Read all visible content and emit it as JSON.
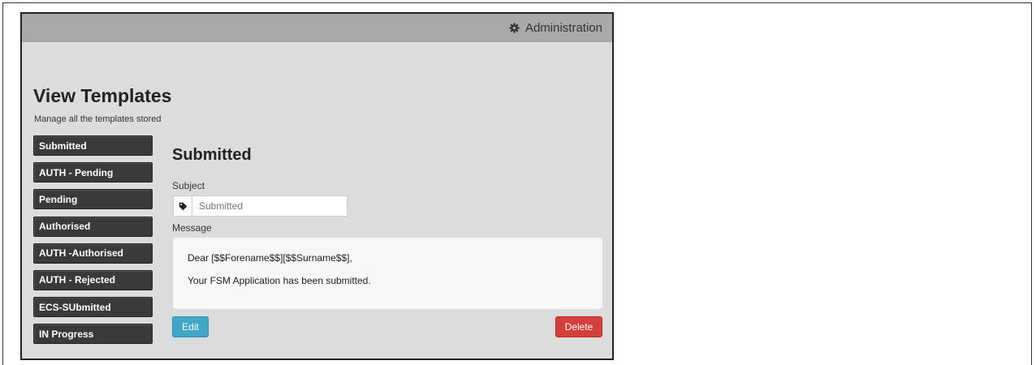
{
  "header": {
    "admin_label": "Administration",
    "admin_icon": "gear-icon"
  },
  "page": {
    "title": "View Templates",
    "subtitle": "Manage all the templates stored"
  },
  "sidebar": {
    "items": [
      {
        "label": "Submitted"
      },
      {
        "label": "AUTH - Pending"
      },
      {
        "label": "Pending"
      },
      {
        "label": "Authorised"
      },
      {
        "label": "AUTH -Authorised"
      },
      {
        "label": "AUTH - Rejected"
      },
      {
        "label": "ECS-SUbmitted"
      },
      {
        "label": "IN Progress"
      }
    ]
  },
  "template": {
    "title": "Submitted",
    "subject_label": "Subject",
    "subject_placeholder": "Submitted",
    "subject_icon": "tag-icon",
    "message_label": "Message",
    "message_lines": [
      "Dear [$$Forename$$][$$Surname$$],",
      "Your FSM Application has been submitted."
    ]
  },
  "actions": {
    "edit_label": "Edit",
    "delete_label": "Delete"
  },
  "colors": {
    "topbar": "#a9a9a9",
    "background": "#dcdcdc",
    "sidebar_item": "#3a3a3a",
    "edit_button": "#41a7c7",
    "delete_button": "#d43f3a"
  }
}
